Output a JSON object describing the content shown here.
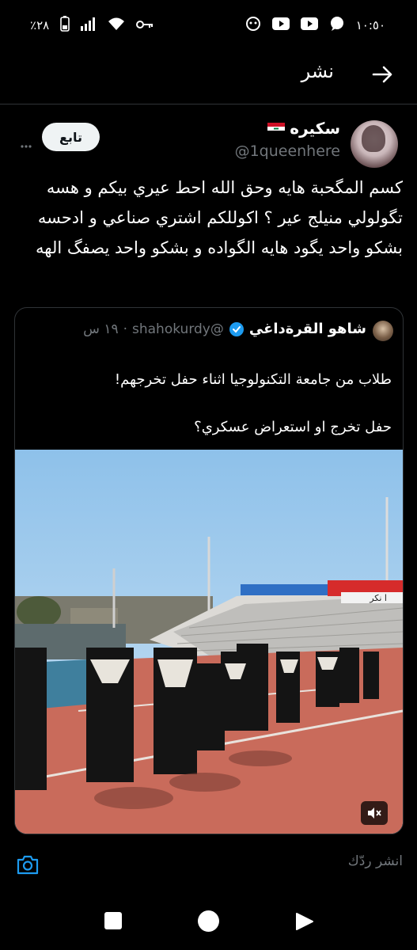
{
  "status_bar": {
    "time": "١٠:٥٠",
    "battery": "٪٢٨",
    "icons": [
      "whatsapp-icon",
      "youtube-icon",
      "youtube-icon",
      "android-icon",
      "key-icon",
      "wifi-icon",
      "signal-icon",
      "battery-icon"
    ]
  },
  "header": {
    "title": "نشر",
    "back_icon": "arrow-right-icon"
  },
  "tweet": {
    "author_name": "سكيره",
    "author_handle": "@1queenhere",
    "follow_label": "تابع",
    "text": "كسم المگحبة هايه وحق الله احط عيري بيكم و هسه تگولولي منيلج عير ؟ اكوللكم اشتري صناعي و ادحسه بشكو واحد يگود هايه الگواده و بشكو واحد يصفگ الهه"
  },
  "quote": {
    "name": "شاهو القرةداغي",
    "handle": "@shahokurdy",
    "time": "١٩ س",
    "line1": "طلاب من جامعة التكنولوجيا اثناء حفل تخرجهم!",
    "line2": "حفل تخرج او استعراض عسكري؟",
    "banner_text": "ا نكر"
  },
  "reply": {
    "placeholder": "انشر ردّك"
  },
  "colors": {
    "background": "#000000",
    "text": "#e7e9ea",
    "muted": "#71767b",
    "divider": "#2f3336",
    "verified": "#1d9bf0"
  }
}
